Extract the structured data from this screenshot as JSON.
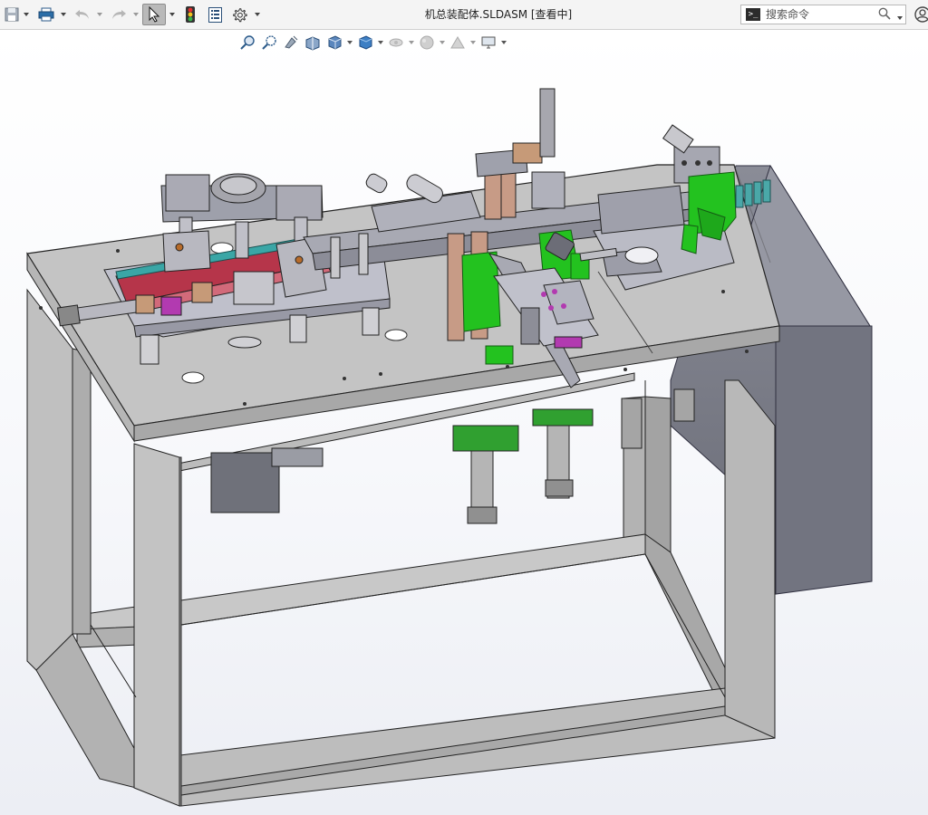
{
  "window": {
    "title": "机总装配体.SLDASM [查看中]"
  },
  "toolbar": {
    "buttons": [
      {
        "name": "save",
        "icon": "save-icon"
      },
      {
        "name": "print",
        "icon": "printer-icon"
      },
      {
        "name": "undo",
        "icon": "undo-icon"
      },
      {
        "name": "redo",
        "icon": "redo-icon"
      },
      {
        "name": "select",
        "icon": "cursor-icon"
      },
      {
        "name": "rebuild",
        "icon": "traffic-light-icon"
      },
      {
        "name": "file-properties",
        "icon": "document-properties-icon"
      },
      {
        "name": "options",
        "icon": "gear-icon"
      }
    ]
  },
  "search": {
    "placeholder": "搜索命令"
  },
  "heads_up_toolbar": {
    "icons": [
      "zoom-to-fit-icon",
      "zoom-area-icon",
      "previous-view-icon",
      "section-view-icon",
      "view-orientation-icon",
      "display-style-icon",
      "hide-show-icon",
      "appearance-icon",
      "scene-icon",
      "view-settings-icon"
    ]
  },
  "viewport": {
    "content": "3D assembly model",
    "colors": {
      "frame": "#c4c4c4",
      "cabinet": "#7d7f89",
      "accent_green": "#21c61e",
      "accent_red": "#b6354a",
      "accent_magenta": "#b23ab0",
      "brass": "#c69a78"
    }
  }
}
